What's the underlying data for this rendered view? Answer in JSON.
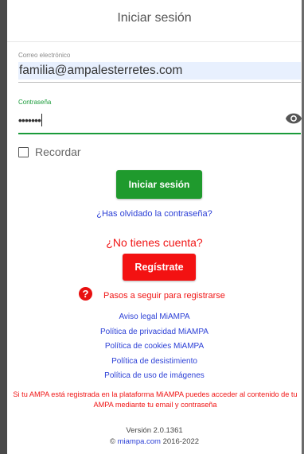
{
  "header": {
    "title": "Iniciar sesión"
  },
  "form": {
    "email_label": "Correo electrónico",
    "email_value": "familia@ampalesterretes.com",
    "password_label": "Contraseña",
    "password_value": "•••••••",
    "remember_label": "Recordar",
    "login_button": "Iniciar sesión",
    "forgot_link": "¿Has olvidado la contraseña?"
  },
  "register": {
    "no_account": "¿No tienes cuenta?",
    "register_button": "Regístrate",
    "steps_link": "Pasos a seguir para registrarse"
  },
  "legal_links": [
    {
      "label": "Aviso legal MiAMPA"
    },
    {
      "label": "Política de privacidad MiAMPA"
    },
    {
      "label": "Política de cookies MiAMPA"
    },
    {
      "label": "Política de desistimiento"
    },
    {
      "label": "Política de uso de imágenes"
    }
  ],
  "info_text": "Si tu AMPA está registrada en la plataforma MiAMPA puedes acceder al contenido de tu AMPA mediante tu email y contraseña",
  "footer": {
    "version": "Versión 2.0.1361",
    "copyright_symbol": "©",
    "site_link": "miampa.com",
    "years": "2016-2022"
  },
  "colors": {
    "accent_green": "#1f9a2d",
    "accent_red": "#f31212",
    "link_blue": "#2b3fd6"
  },
  "icons": {
    "password_toggle": "eye-icon",
    "help": "question-circle-icon"
  }
}
